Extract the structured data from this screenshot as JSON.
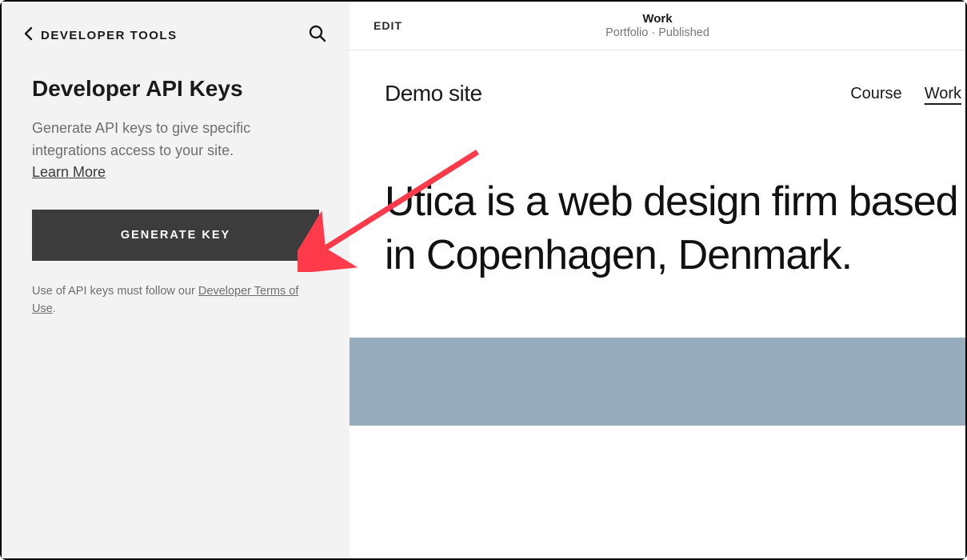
{
  "sidebar": {
    "back_label": "DEVELOPER TOOLS",
    "title": "Developer API Keys",
    "description": "Generate API keys to give specific integrations access to your site.",
    "learn_more": "Learn More",
    "generate_button": "GENERATE KEY",
    "terms_prefix": "Use of API keys must follow our ",
    "terms_link": "Developer Terms of Use",
    "terms_suffix": "."
  },
  "preview": {
    "edit_label": "EDIT",
    "page_title": "Work",
    "page_sub": "Portfolio · Published",
    "site_title": "Demo site",
    "nav": {
      "item1": "Course",
      "item2": "Work"
    },
    "hero": "Utica is a web design firm based in Copenhagen, Denmark."
  }
}
